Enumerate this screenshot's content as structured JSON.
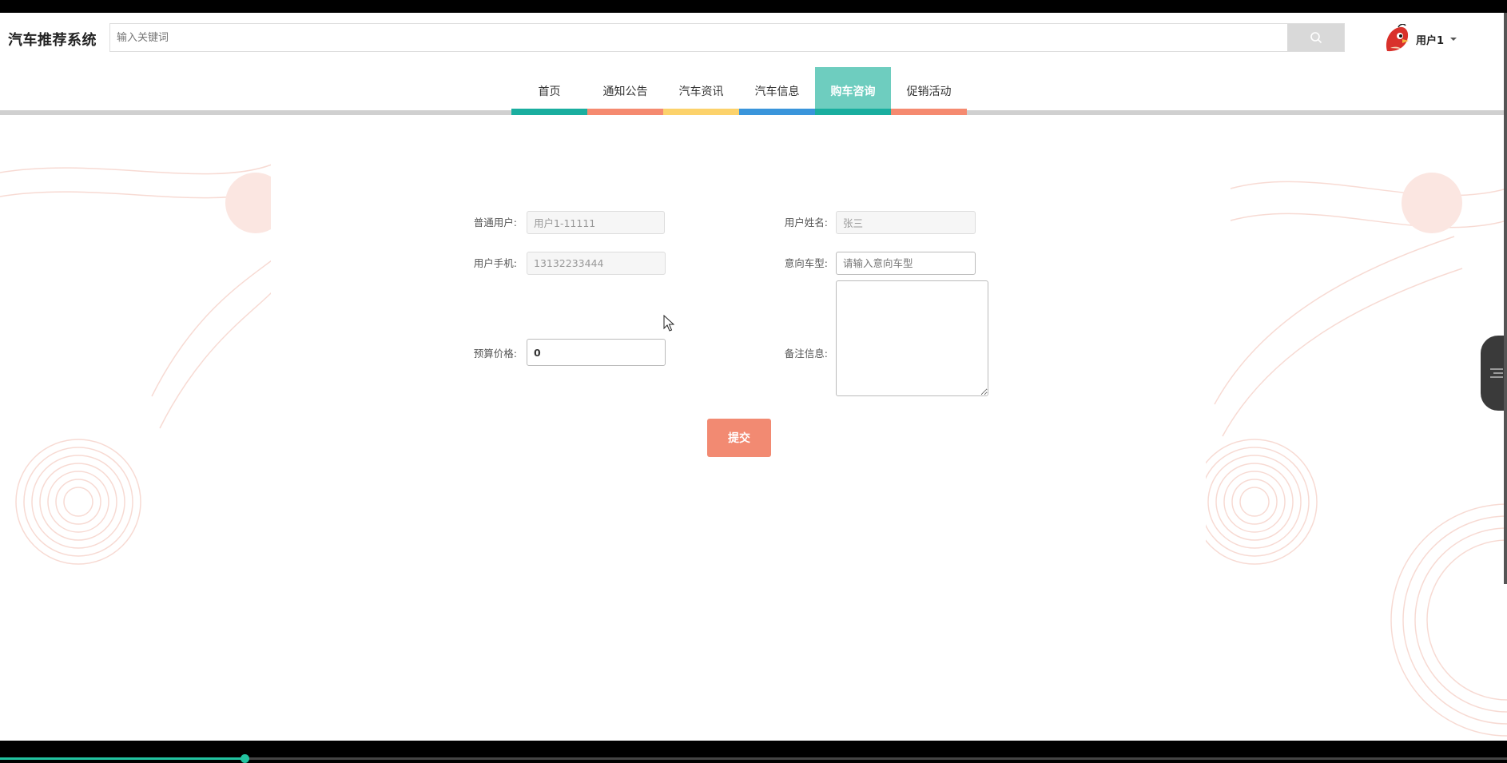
{
  "header": {
    "logo": "汽车推荐系统",
    "search_placeholder": "输入关键词",
    "user_name": "用户1"
  },
  "nav": {
    "items": [
      {
        "label": "首页",
        "color": "#1aae9f"
      },
      {
        "label": "通知公告",
        "color": "#f58a70"
      },
      {
        "label": "汽车资讯",
        "color": "#fcd26b"
      },
      {
        "label": "汽车信息",
        "color": "#3a95db"
      },
      {
        "label": "购车咨询",
        "color": "#1aae9f"
      },
      {
        "label": "促销活动",
        "color": "#f58a70"
      }
    ],
    "active_index": 4
  },
  "form": {
    "user_label": "普通用户:",
    "user_value": "用户1-11111",
    "name_label": "用户姓名:",
    "name_value": "张三",
    "phone_label": "用户手机:",
    "phone_value": "13132233444",
    "car_model_label": "意向车型:",
    "car_model_placeholder": "请输入意向车型",
    "budget_label": "预算价格:",
    "budget_value": "0",
    "remarks_label": "备注信息:",
    "remarks_value": "",
    "submit_label": "提交"
  },
  "player": {
    "progress_fraction": 0.162
  },
  "colors": {
    "accent": "#6ecdbf",
    "submit": "#f28a72",
    "swirl": "#f6d2c9"
  }
}
